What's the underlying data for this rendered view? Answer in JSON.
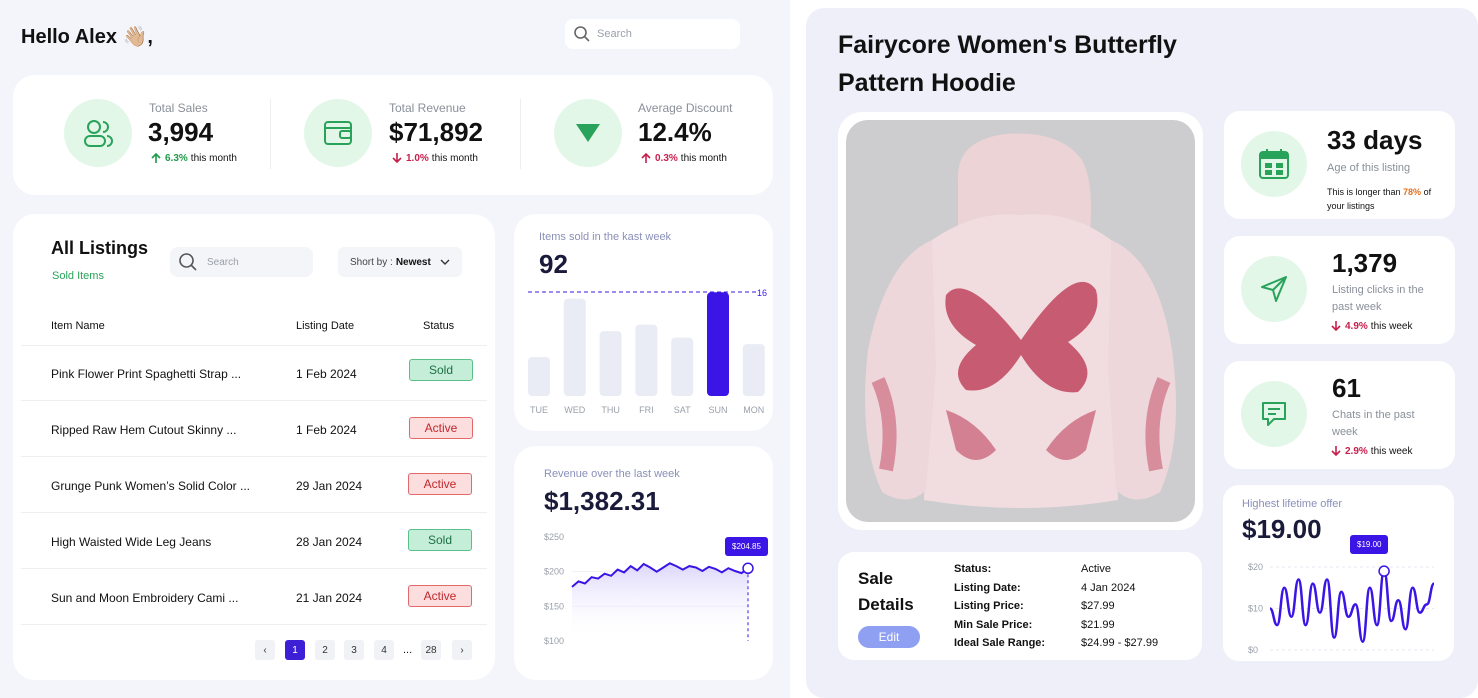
{
  "dashboard": {
    "greeting": "Hello Alex 👋🏼,",
    "search_placeholder": "Search",
    "stats": [
      {
        "label": "Total Sales",
        "value": "3,994",
        "delta": "6.3%",
        "delta_text": "this month",
        "direction": "up",
        "icon": "users-icon"
      },
      {
        "label": "Total Revenue",
        "value": "$71,892",
        "delta": "1.0%",
        "delta_text": "this month",
        "direction": "down",
        "icon": "wallet-icon"
      },
      {
        "label": "Average Discount",
        "value": "12.4%",
        "delta": "0.3%",
        "delta_text": "this month",
        "direction": "up",
        "icon": "triangle-down-icon"
      }
    ],
    "listings": {
      "title": "All Listings",
      "subtitle": "Sold Items",
      "search_placeholder": "Search",
      "sort_label": "Short by :",
      "sort_value": "Newest",
      "columns": [
        "Item Name",
        "Listing Date",
        "Status"
      ],
      "rows": [
        {
          "name": "Pink Flower Print Spaghetti Strap ...",
          "date": "1 Feb 2024",
          "status": "Sold"
        },
        {
          "name": "Ripped Raw Hem Cutout Skinny ...",
          "date": "1 Feb 2024",
          "status": "Active"
        },
        {
          "name": "Grunge Punk Women’s Solid Color ...",
          "date": "29 Jan 2024",
          "status": "Active"
        },
        {
          "name": "High Waisted Wide Leg Jeans",
          "date": "28 Jan 2024",
          "status": "Sold"
        },
        {
          "name": "Sun and Moon Embroidery Cami ...",
          "date": "21 Jan 2024",
          "status": "Active"
        }
      ],
      "pagination": {
        "prev": "‹",
        "pages": [
          "1",
          "2",
          "3",
          "4"
        ],
        "ellipsis": "...",
        "last": "28",
        "next": "›",
        "current": "1"
      }
    },
    "items_sold": {
      "title": "Items sold in the kast week",
      "value": "92",
      "marker_label": "16"
    },
    "revenue": {
      "title": "Revenue over the last week",
      "value": "$1,382.31",
      "tooltip": "$204.85"
    }
  },
  "product": {
    "title_line1": "Fairycore Women's Butterfly",
    "title_line2": "Pattern Hoodie",
    "age": {
      "value": "33 days",
      "label": "Age of this listing",
      "note_pre": "This is longer than ",
      "note_pct": "78%",
      "note_mid": " of",
      "note_post": "your listings"
    },
    "clicks": {
      "value": "1,379",
      "label1": "Listing clicks in the",
      "label2": "past week",
      "delta": "4.9%",
      "delta_text": "this week"
    },
    "chats": {
      "value": "61",
      "label1": "Chats in the past",
      "label2": "week",
      "delta": "2.9%",
      "delta_text": "this week"
    },
    "offer": {
      "title": "Highest lifetime offer",
      "value": "$19.00",
      "tooltip": "$19.00"
    },
    "sale_details": {
      "title1": "Sale",
      "title2": "Details",
      "edit_label": "Edit",
      "fields": [
        {
          "label": "Status:",
          "value": "Active"
        },
        {
          "label": "Listing Date:",
          "value": "4 Jan 2024"
        },
        {
          "label": "Listing Price:",
          "value": "$27.99"
        },
        {
          "label": "Min Sale Price:",
          "value": "$21.99"
        },
        {
          "label": "Ideal Sale Range:",
          "value": "$24.99 - $27.99"
        }
      ]
    }
  },
  "chart_data": [
    {
      "type": "bar",
      "title": "Items sold in the kast week",
      "categories": [
        "TUE",
        "WED",
        "THU",
        "FRI",
        "SAT",
        "SUN",
        "MON"
      ],
      "values": [
        6,
        15,
        10,
        11,
        9,
        16,
        8
      ],
      "highlight": "SUN",
      "ylim": [
        0,
        17
      ],
      "grid": false
    },
    {
      "type": "area",
      "title": "Revenue over the last week",
      "y_ticks": [
        "$250",
        "$200",
        "$150",
        "$100"
      ],
      "ylim": [
        100,
        250
      ],
      "values": [
        178,
        186,
        183,
        192,
        190,
        197,
        194,
        203,
        199,
        208,
        202,
        211,
        206,
        200,
        206,
        212,
        208,
        203,
        208,
        206,
        201,
        207,
        204,
        199,
        205,
        201,
        198,
        204.85
      ],
      "highlight_value": 204.85,
      "grid": true
    },
    {
      "type": "line",
      "title": "Highest lifetime offer",
      "y_ticks": [
        "$20",
        "$10",
        "$0"
      ],
      "ylim": [
        0,
        20
      ],
      "values": [
        10,
        6,
        15,
        8,
        17,
        6,
        16,
        9,
        17,
        3,
        14,
        8,
        11,
        2,
        15,
        6,
        19,
        7,
        12,
        5,
        15,
        9,
        11,
        16
      ],
      "highlight_value": 19,
      "grid": true
    }
  ]
}
